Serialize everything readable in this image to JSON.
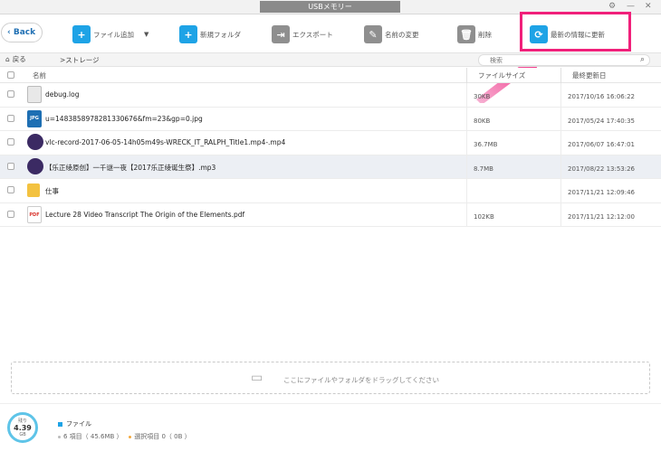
{
  "window": {
    "title": "USBメモリー",
    "settings_icon": "gear-icon",
    "minimize": "—",
    "close": "✕"
  },
  "toolbar": {
    "back_label": "Back",
    "add_file_label": "ファイル追加",
    "new_folder_label": "新規フォルダ",
    "export_label": "エクスポート",
    "rename_label": "名前の変更",
    "delete_label": "削除",
    "refresh_label": "最新の情報に更新"
  },
  "address": {
    "back_label": "戻る",
    "breadcrumb": ">ストレージ",
    "search_placeholder": "検索"
  },
  "table": {
    "headers": {
      "name": "名前",
      "size": "ファイルサイズ",
      "date": "最終更新日"
    },
    "rows": [
      {
        "name": "debug.log",
        "size": "30KB",
        "date": "2017/10/16 16:06:22",
        "icon": "document-icon",
        "color": "#e8e8e8"
      },
      {
        "name": "u=1483858978281330676&fm=23&gp=0.jpg",
        "size": "80KB",
        "date": "2017/05/24 17:40:35",
        "icon": "image-file-icon",
        "color": "#1e6fb3"
      },
      {
        "name": "vlc-record-2017-06-05-14h05m49s-WRECK_IT_RALPH_Title1.mp4-.mp4",
        "size": "36.7MB",
        "date": "2017/06/07 16:47:01",
        "icon": "video-file-icon",
        "color": "#3b2a63"
      },
      {
        "name": "【乐正绫原创】一千谜一夜【2017乐正绫诞生祭】.mp3",
        "size": "8.7MB",
        "date": "2017/08/22 13:53:26",
        "icon": "audio-file-icon",
        "color": "#3b2a63"
      },
      {
        "name": "仕事",
        "size": "",
        "date": "2017/11/21 12:09:46",
        "icon": "folder-icon",
        "color": "#f3c240"
      },
      {
        "name": "Lecture 28 Video Transcript The Origin of the Elements.pdf",
        "size": "102KB",
        "date": "2017/11/21 12:12:00",
        "icon": "pdf-file-icon",
        "color": "#d9352e"
      }
    ]
  },
  "dropzone": {
    "text": "ここにファイルやフォルダをドラッグしてください"
  },
  "footer": {
    "gauge_label": "残り",
    "gauge_value": "4.39",
    "gauge_unit": "GB",
    "category_label": "ファイル",
    "items_text": "6 項目（ 45.6MB ）",
    "selected_text": "選択項目 0（ 0B ）"
  },
  "colors": {
    "accent": "#1ea3e6",
    "highlight": "#f0207a"
  }
}
